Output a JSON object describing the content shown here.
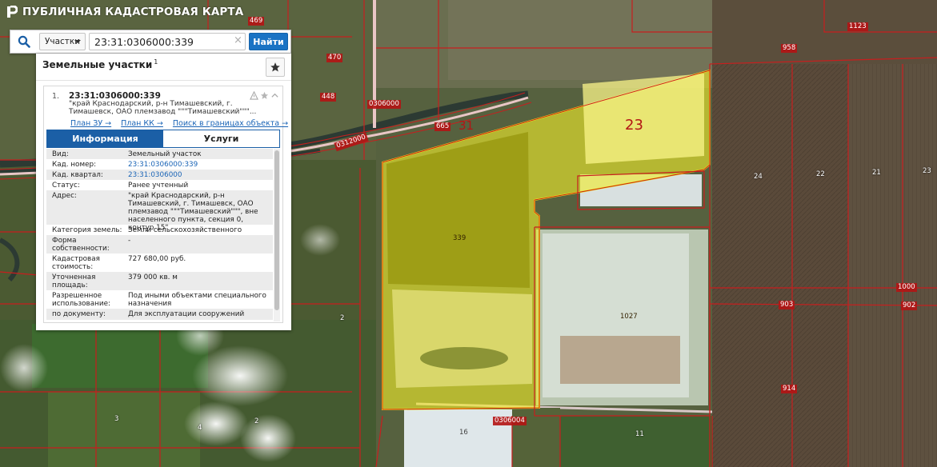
{
  "app": {
    "title": "ПУБЛИЧНАЯ КАДАСТРОВАЯ КАРТА",
    "logo_icon": "rosreestr-logo-icon"
  },
  "search": {
    "icon": "search-icon",
    "mode_label": "Участки",
    "query": "23:31:0306000:339",
    "clear_icon": "close-icon",
    "clear_glyph": "×",
    "submit_label": "Найти"
  },
  "panel": {
    "title": "Земельные участки",
    "count": "1",
    "favorite_icon": "star-icon",
    "result": {
      "index": "1.",
      "number": "23:31:0306000:339",
      "address_line1": "\"край Краснодарский, р-н Тимашевский, г.",
      "address_line2": "Тимашевск, ОАО племзавод \"\"\"Тимашевский\"\"\"...",
      "tool_icons": [
        "warning-icon",
        "star-icon",
        "chevron-up-icon"
      ],
      "links": [
        "План ЗУ →",
        "План КК →",
        "Поиск в границах объекта →"
      ],
      "tabs": {
        "info": "Информация",
        "services": "Услуги"
      },
      "attributes": [
        {
          "label": "Вид:",
          "value": "Земельный участок"
        },
        {
          "label": "Кад. номер:",
          "value": "23:31:0306000:339",
          "link": true
        },
        {
          "label": "Кад. квартал:",
          "value": "23:31:0306000",
          "link": true
        },
        {
          "label": "Статус:",
          "value": "Ранее учтенный"
        },
        {
          "label": "Адрес:",
          "value": "\"край Краснодарский, р-н Тимашевский, г. Тимашевск, ОАО племзавод \"\"\"Тимашевский\"\"\", вне населенного пункта, секция 0, контур 15\""
        },
        {
          "label": "Категория земель:",
          "value": "Земли сельскохозяйственного назначения"
        },
        {
          "label": "Форма собственности:",
          "value": "-"
        },
        {
          "label": "Кадастровая стоимость:",
          "value": "727 680,00 руб."
        },
        {
          "label": "Уточненная площадь:",
          "value": "379 000 кв. м"
        },
        {
          "label": "Разрешенное использование:",
          "value": "Под иными объектами специального назначения"
        },
        {
          "label": "по документу:",
          "value": "Для эксплуатации сооружений"
        }
      ]
    }
  },
  "map": {
    "highlight_color": "#f0ec2a",
    "boundary_color": "#c81e1e",
    "labels": [
      "469",
      "470",
      "448",
      "0306000",
      "665",
      "31",
      "0312000",
      "23",
      "339",
      "1123",
      "958",
      "24",
      "22",
      "21",
      "23",
      "1027",
      "1000",
      "903",
      "902",
      "914",
      "2",
      "3",
      "2",
      "4",
      "16",
      "0306004",
      "11"
    ]
  }
}
